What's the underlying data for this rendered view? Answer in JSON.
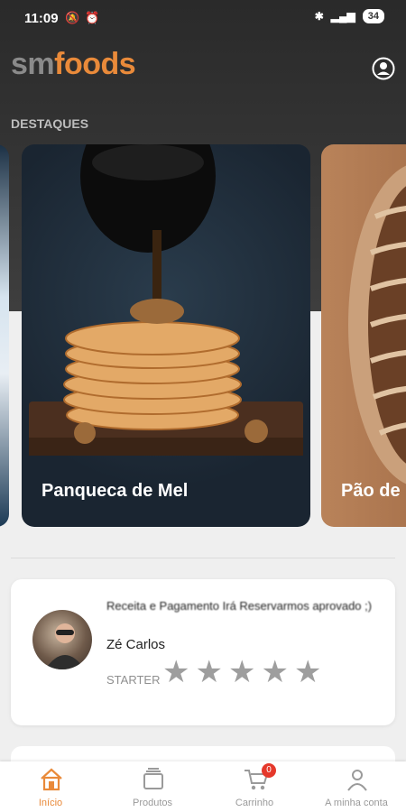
{
  "status_bar": {
    "time": "11:09",
    "battery": "34"
  },
  "header": {
    "logo_sm": "sm",
    "logo_foods": "foods",
    "profile_icon": "account-circle-icon"
  },
  "featured": {
    "title": "DESTAQUES",
    "cards": [
      {
        "title": "Panqueca de Mel"
      },
      {
        "title": "Pão de"
      }
    ]
  },
  "review": {
    "text": "Receita e Pagamento Irá Reservarmos aprovado ;)",
    "name": "Zé Carlos",
    "level": "STARTER",
    "stars": 5
  },
  "bottom_nav": {
    "items": [
      {
        "label": "Início",
        "icon": "home-icon",
        "active": true
      },
      {
        "label": "Produtos",
        "icon": "products-icon"
      },
      {
        "label": "Carrinho",
        "icon": "cart-icon",
        "badge": "0"
      },
      {
        "label": "A minha conta",
        "icon": "user-icon"
      }
    ]
  },
  "colors": {
    "accent": "#e98a3a",
    "dark_header": "#2f2f2f",
    "badge": "#e5382b"
  }
}
